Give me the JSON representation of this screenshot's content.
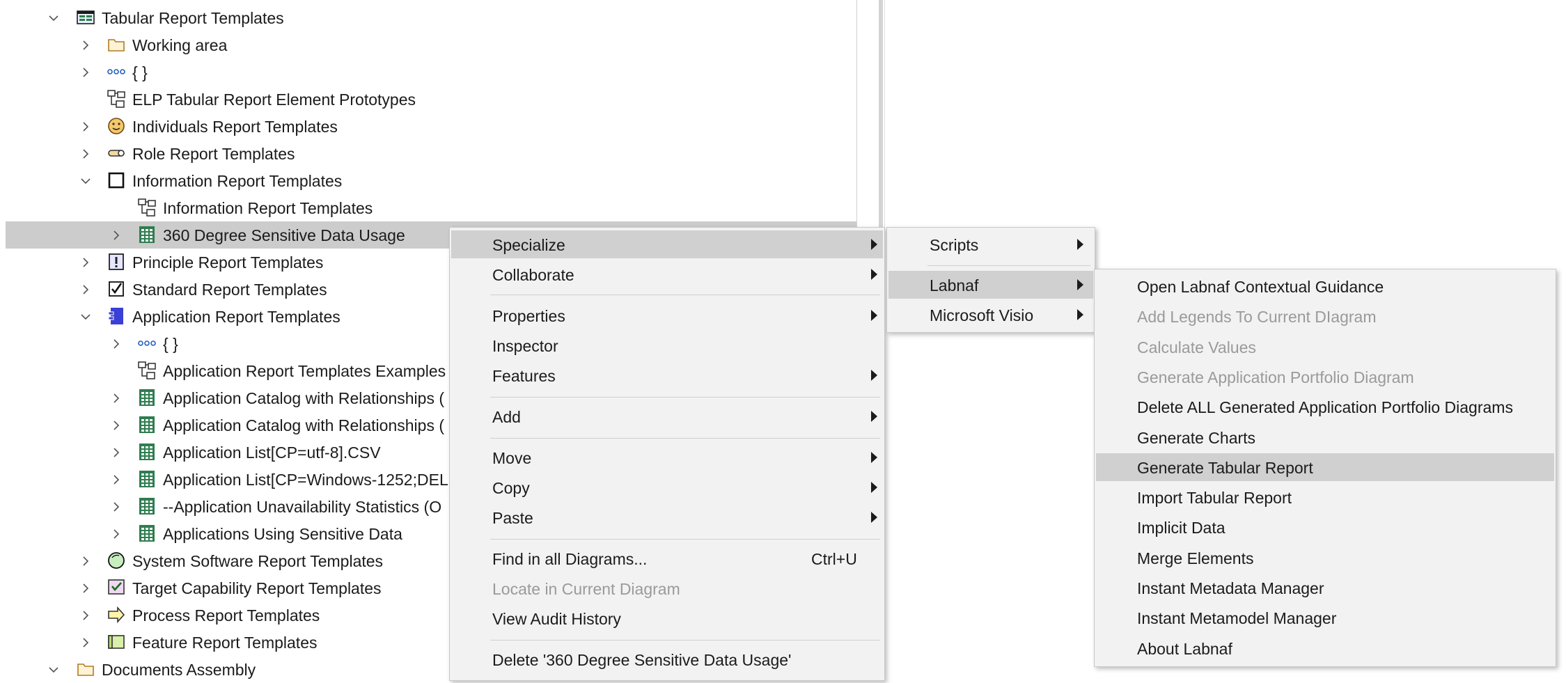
{
  "tree": {
    "items": [
      {
        "label": "Tabular Report Templates",
        "icon": "package-tabular-icon",
        "chevron": "expanded"
      },
      {
        "label": "Working area",
        "icon": "folder-icon",
        "chevron": "collapsed"
      },
      {
        "label": "{ }",
        "icon": "ellipsis-icon",
        "chevron": "collapsed"
      },
      {
        "label": "ELP Tabular Report Element Prototypes",
        "icon": "diagram-icon",
        "chevron": "none"
      },
      {
        "label": "Individuals Report Templates",
        "icon": "smiley-icon",
        "chevron": "collapsed"
      },
      {
        "label": "Role Report Templates",
        "icon": "role-icon",
        "chevron": "collapsed"
      },
      {
        "label": "Information Report Templates",
        "icon": "square-outline-icon",
        "chevron": "expanded"
      },
      {
        "label": "Information Report Templates",
        "icon": "diagram-icon",
        "chevron": "none"
      },
      {
        "label": "360 Degree Sensitive Data Usage",
        "icon": "table-grid-icon",
        "chevron": "collapsed"
      },
      {
        "label": "Principle Report Templates",
        "icon": "principle-icon",
        "chevron": "collapsed"
      },
      {
        "label": "Standard Report Templates",
        "icon": "checkbox-icon",
        "chevron": "collapsed"
      },
      {
        "label": "Application Report Templates",
        "icon": "application-icon",
        "chevron": "expanded"
      },
      {
        "label": "{ }",
        "icon": "ellipsis-icon",
        "chevron": "collapsed"
      },
      {
        "label": "Application Report Templates Examples",
        "icon": "diagram-icon",
        "chevron": "none"
      },
      {
        "label": "Application Catalog with Relationships (",
        "icon": "table-grid-icon",
        "chevron": "collapsed"
      },
      {
        "label": "Application Catalog with Relationships (",
        "icon": "table-grid-icon",
        "chevron": "collapsed"
      },
      {
        "label": "Application List[CP=utf-8].CSV",
        "icon": "table-grid-icon",
        "chevron": "collapsed"
      },
      {
        "label": "Application List[CP=Windows-1252;DEL",
        "icon": "table-grid-icon",
        "chevron": "collapsed"
      },
      {
        "label": "--Application Unavailability Statistics (O",
        "icon": "table-grid-icon",
        "chevron": "collapsed"
      },
      {
        "label": "Applications Using Sensitive Data",
        "icon": "table-grid-icon",
        "chevron": "collapsed"
      },
      {
        "label": "System Software Report Templates",
        "icon": "circle-icon",
        "chevron": "collapsed"
      },
      {
        "label": "Target Capability Report Templates",
        "icon": "capability-icon",
        "chevron": "collapsed"
      },
      {
        "label": "Process Report Templates",
        "icon": "process-arrow-icon",
        "chevron": "collapsed"
      },
      {
        "label": "Feature Report Templates",
        "icon": "feature-icon",
        "chevron": "collapsed"
      },
      {
        "label": "Documents Assembly",
        "icon": "folder-icon",
        "chevron": "expanded"
      }
    ]
  },
  "context_menu": {
    "items": [
      {
        "label": "Specialize",
        "submenu": true
      },
      {
        "label": "Collaborate",
        "submenu": true
      },
      {
        "label": "Properties",
        "submenu": true
      },
      {
        "label": "Inspector",
        "submenu": false
      },
      {
        "label": "Features",
        "submenu": true
      },
      {
        "label": "Add",
        "submenu": true
      },
      {
        "label": "Move",
        "submenu": true
      },
      {
        "label": "Copy",
        "submenu": true
      },
      {
        "label": "Paste",
        "submenu": true
      },
      {
        "label": "Find in all Diagrams...",
        "shortcut": "Ctrl+U"
      },
      {
        "label": "Locate in Current Diagram",
        "disabled": true
      },
      {
        "label": "View Audit History"
      },
      {
        "label": "Delete '360 Degree Sensitive Data Usage'"
      }
    ]
  },
  "specialize_menu": {
    "items": [
      {
        "label": "Scripts",
        "submenu": true
      },
      {
        "label": "Labnaf",
        "submenu": true
      },
      {
        "label": "Microsoft Visio",
        "submenu": true
      }
    ]
  },
  "labnaf_menu": {
    "items": [
      {
        "label": "Open Labnaf Contextual Guidance"
      },
      {
        "label": "Add Legends To Current DIagram",
        "disabled": true
      },
      {
        "label": "Calculate Values",
        "disabled": true
      },
      {
        "label": "Generate Application Portfolio Diagram",
        "disabled": true
      },
      {
        "label": "Delete ALL Generated Application Portfolio Diagrams"
      },
      {
        "label": "Generate Charts"
      },
      {
        "label": "Generate Tabular Report"
      },
      {
        "label": "Import Tabular Report"
      },
      {
        "label": "Implicit Data"
      },
      {
        "label": "Merge Elements"
      },
      {
        "label": "Instant Metadata Manager"
      },
      {
        "label": "Instant Metamodel Manager"
      },
      {
        "label": "About Labnaf"
      }
    ]
  },
  "colors": {
    "selection": "#cccccc",
    "menu_bg": "#f2f2f2",
    "menu_highlight": "#d0d0d0",
    "disabled_text": "#9a9a9a",
    "grid_icon": "#2e7d4f"
  }
}
